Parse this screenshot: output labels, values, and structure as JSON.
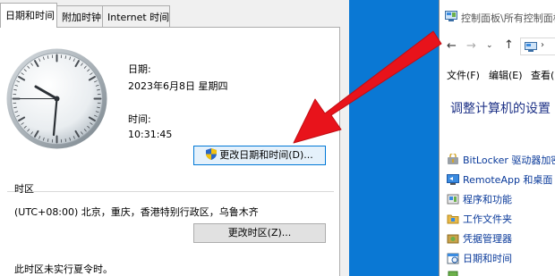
{
  "dialog": {
    "tabs": [
      "日期和时间",
      "附加时钟",
      "Internet 时间"
    ],
    "date_label": "日期:",
    "date_value": "2023年6月8日 星期四",
    "time_label": "时间:",
    "time_value": "10:31:45",
    "change_datetime_button": "更改日期和时间(D)...",
    "timezone_header": "时区",
    "timezone_value": "(UTC+08:00) 北京，重庆，香港特别行政区，乌鲁木齐",
    "change_timezone_button": "更改时区(Z)...",
    "dst_note": "此时区未实行夏令时。"
  },
  "control_panel": {
    "title": "控制面板\\所有控制面板",
    "menu": [
      "文件(F)",
      "编辑(E)",
      "查看("
    ],
    "heading": "调整计算机的设置",
    "items": [
      "BitLocker 驱动器加密",
      "RemoteApp 和桌面",
      "程序和功能",
      "工作文件夹",
      "凭据管理器",
      "日期和时间",
      ""
    ]
  },
  "colors": {
    "desktop": "#0a78d4",
    "arrow": "#e8131b",
    "link": "#0a3a9a",
    "heading": "#1e3287"
  }
}
